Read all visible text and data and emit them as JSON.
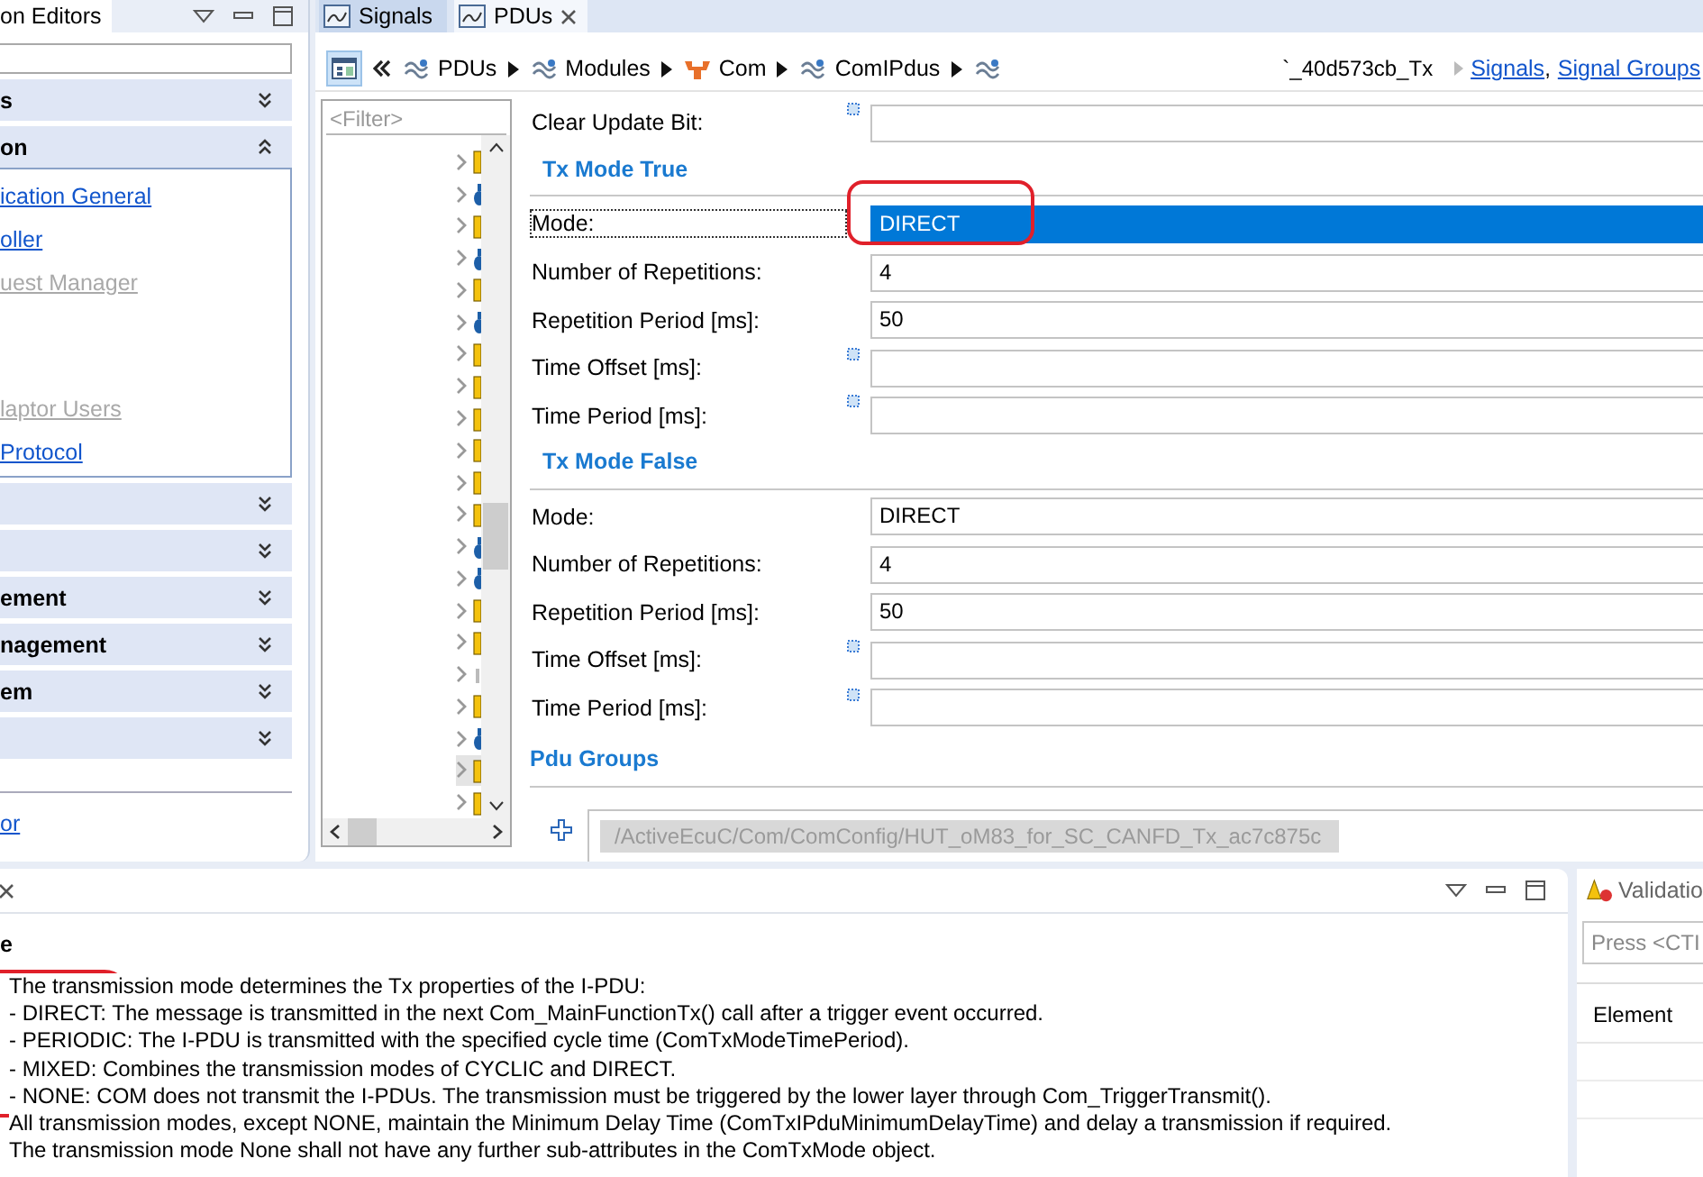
{
  "left_panel": {
    "tab": "on Editors",
    "sections": [
      {
        "title": "s",
        "expanded": false
      },
      {
        "title": "on",
        "expanded": true,
        "groups": [
          [
            {
              "label": "ication General",
              "disabled": false
            },
            {
              "label": "oller",
              "disabled": false
            },
            {
              "label": "uest Manager",
              "disabled": true
            }
          ],
          [
            {
              "label": "laptor Users",
              "disabled": true
            },
            {
              "label": "Protocol",
              "disabled": false
            }
          ]
        ]
      },
      {
        "expanded": false
      },
      {
        "expanded": false
      },
      {
        "title": "ement",
        "expanded": false
      },
      {
        "title": "nagement",
        "expanded": false
      },
      {
        "title": "em",
        "expanded": false
      },
      {
        "expanded": false
      }
    ],
    "footer_link": "or"
  },
  "editor": {
    "tabs": [
      {
        "label": "Signals",
        "selected": false
      },
      {
        "label": "PDUs",
        "selected": true
      }
    ],
    "breadcrumb": [
      {
        "label": "PDUs",
        "kind": "container"
      },
      {
        "label": "Modules",
        "kind": "container"
      },
      {
        "label": "Com",
        "kind": "module"
      },
      {
        "label": "ComIPdus",
        "kind": "container"
      },
      {
        "kind": "pdu"
      }
    ],
    "breadcrumb_tail": "`_40d573cb_Tx",
    "links": [
      "Signals",
      "Signal Groups"
    ],
    "link_separator": ",",
    "tree": {
      "filter_placeholder": "<Filter>",
      "rows": [
        {
          "kind": "yellow",
          "selected": false
        },
        {
          "kind": "blue",
          "selected": false
        },
        {
          "kind": "yellow",
          "selected": false
        },
        {
          "kind": "blue",
          "selected": false
        },
        {
          "kind": "yellow",
          "selected": false
        },
        {
          "kind": "blue",
          "selected": false
        },
        {
          "kind": "yellow",
          "selected": false
        },
        {
          "kind": "yellow",
          "selected": false
        },
        {
          "kind": "yellow",
          "selected": false
        },
        {
          "kind": "yellow",
          "selected": false
        },
        {
          "kind": "yellow",
          "selected": false
        },
        {
          "kind": "yellow",
          "selected": false
        },
        {
          "kind": "blue",
          "selected": false
        },
        {
          "kind": "blue",
          "selected": false
        },
        {
          "kind": "yellow",
          "selected": false
        },
        {
          "kind": "yellow",
          "selected": false
        },
        {
          "kind": "faint",
          "selected": false
        },
        {
          "kind": "yellow",
          "selected": false
        },
        {
          "kind": "blue",
          "selected": false
        },
        {
          "kind": "yellow",
          "selected": true
        },
        {
          "kind": "yellow",
          "selected": false
        }
      ]
    },
    "form": [
      {
        "kind": "field",
        "label": "Clear Update Bit:",
        "default": true
      },
      {
        "kind": "heading",
        "label": "Tx Mode True"
      },
      {
        "kind": "field",
        "label": "Mode:",
        "value": "DIRECT",
        "selected": true,
        "circled": true
      },
      {
        "kind": "field",
        "label": "Number of Repetitions:",
        "value": "4",
        "selected": false
      },
      {
        "kind": "field",
        "label": "Repetition Period [ms]:",
        "value": "50",
        "selected": false
      },
      {
        "kind": "field",
        "label": "Time Offset [ms]:",
        "default": true,
        "selected": false
      },
      {
        "kind": "field",
        "label": "Time Period [ms]:",
        "default": true,
        "selected": false
      },
      {
        "kind": "heading",
        "label": "Tx Mode False"
      },
      {
        "kind": "field",
        "label": "Mode:",
        "value": "DIRECT",
        "selected": false
      },
      {
        "kind": "field",
        "label": "Number of Repetitions:",
        "value": "4",
        "selected": false
      },
      {
        "kind": "field",
        "label": "Repetition Period [ms]:",
        "value": "50",
        "selected": false
      },
      {
        "kind": "field",
        "label": "Time Offset [ms]:",
        "default": true,
        "selected": false
      },
      {
        "kind": "field",
        "label": "Time Period [ms]:",
        "default": true,
        "selected": false
      },
      {
        "kind": "group_heading",
        "label": "Pdu Groups"
      },
      {
        "kind": "reference",
        "value": "/ActiveEcuC/Com/ComConfig/HUT_oM83_for_SC_CANFD_Tx_ac7c875c"
      }
    ]
  },
  "description_panel": {
    "title": "e",
    "circled": true,
    "lines": [
      "The transmission mode determines the Tx properties of the I-PDU:",
      "- DIRECT: The message is transmitted in the next Com_MainFunctionTx() call after a trigger event occurred.",
      "- PERIODIC: The I-PDU is transmitted with the specified cycle time (ComTxModeTimePeriod).",
      "- MIXED: Combines the transmission modes of CYCLIC and DIRECT.",
      "- NONE: COM does not transmit the I-PDUs. The transmission must be triggered by the lower layer through Com_TriggerTransmit().",
      "All transmission modes, except NONE, maintain the Minimum Delay Time (ComTxIPduMinimumDelayTime) and delay a transmission if required.",
      "The transmission mode None shall not have any further sub-attributes in the ComTxMode object."
    ]
  },
  "validation_panel": {
    "tab": "Validatio",
    "search_placeholder": "Press <CTI",
    "column": "Element"
  }
}
